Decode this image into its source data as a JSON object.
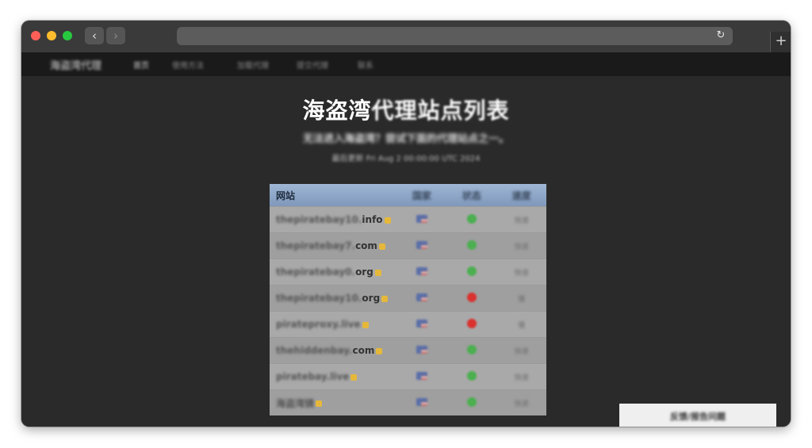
{
  "site": {
    "brand": "海盗湾代理",
    "nav": [
      "首页",
      "使用方法",
      "加载代理",
      "提交代理",
      "联系"
    ]
  },
  "hero": {
    "title_lead": "海盗湾",
    "title_rest": "代理站点列表",
    "subtitle": "无法进入海盗湾？尝试下面的代理站点之一。",
    "updated": "最后更新 Fri Aug 2 00:00:00 UTC 2024"
  },
  "table": {
    "headers": {
      "site": "网站",
      "country": "国家",
      "status": "状态",
      "speed": "速度"
    },
    "rows": [
      {
        "blur": "thepiratebay10.",
        "tail": "info",
        "status": "up",
        "speed": "快速"
      },
      {
        "blur": "thepiratebay7.",
        "tail": "com",
        "status": "up",
        "speed": "快速"
      },
      {
        "blur": "thepiratebay0.",
        "tail": "org",
        "status": "up",
        "speed": "快速"
      },
      {
        "blur": "thepiratebay10.",
        "tail": "org",
        "status": "down",
        "speed": "慢"
      },
      {
        "blur": "pirateproxy.live",
        "tail": "",
        "status": "down",
        "speed": "慢"
      },
      {
        "blur": "thehiddenbay.",
        "tail": "com",
        "status": "up",
        "speed": "快速"
      },
      {
        "blur": "piratebay.live",
        "tail": "",
        "status": "up",
        "speed": "快速"
      },
      {
        "blur": "海盗湾镜",
        "tail": "",
        "status": "up",
        "speed": "快速"
      }
    ]
  },
  "report_button": "反馈/报告问题",
  "colors": {
    "up": "#4caf50",
    "down": "#d9322f",
    "header_bg": "#8ea6c8"
  },
  "icons": {
    "reload": "reload-icon",
    "new_tab": "plus-icon",
    "lock": "lock-icon",
    "flag": "us-flag-icon"
  }
}
